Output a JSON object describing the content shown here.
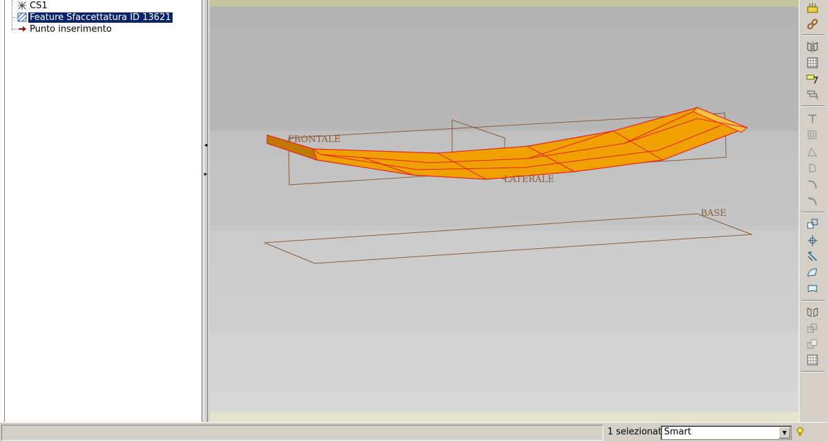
{
  "model_tree": {
    "items": [
      {
        "label": "CS1",
        "icon": "coordinate-system-icon"
      },
      {
        "label": "Feature Sfaccettatura ID 13621",
        "icon": "facet-feature-icon",
        "selected": true
      },
      {
        "label": "Punto inserimento",
        "icon": "insert-point-arrow-icon"
      }
    ]
  },
  "viewport": {
    "planes": {
      "front": "FRONTALE",
      "side": "LATERALE",
      "base": "BASE"
    },
    "colors": {
      "part_fill": "#f0a000",
      "part_edge": "#e8201c",
      "datum_plane": "#8a5a3a",
      "background_top": "#b4b4b4",
      "background_bottom": "#d8d8d8"
    }
  },
  "right_toolbar": {
    "icons": [
      "datum-display-icon",
      "chain-link-icon",
      "mirror-icon",
      "grid-icon",
      "sketch-icon",
      "layers-icon",
      "trim-icon",
      "box-icon",
      "draft-icon",
      "rotate-icon",
      "curve-icon",
      "curve-alt-icon",
      "offset-icon",
      "axis-icon",
      "pattern-icon",
      "surface-icon",
      "flag-icon",
      "mirror-alt-icon",
      "copy-icon",
      "copy-alt-icon",
      "grid-alt-icon"
    ]
  },
  "status_bar": {
    "selection_count": "1 selezionat",
    "filter_value": "Smart"
  }
}
